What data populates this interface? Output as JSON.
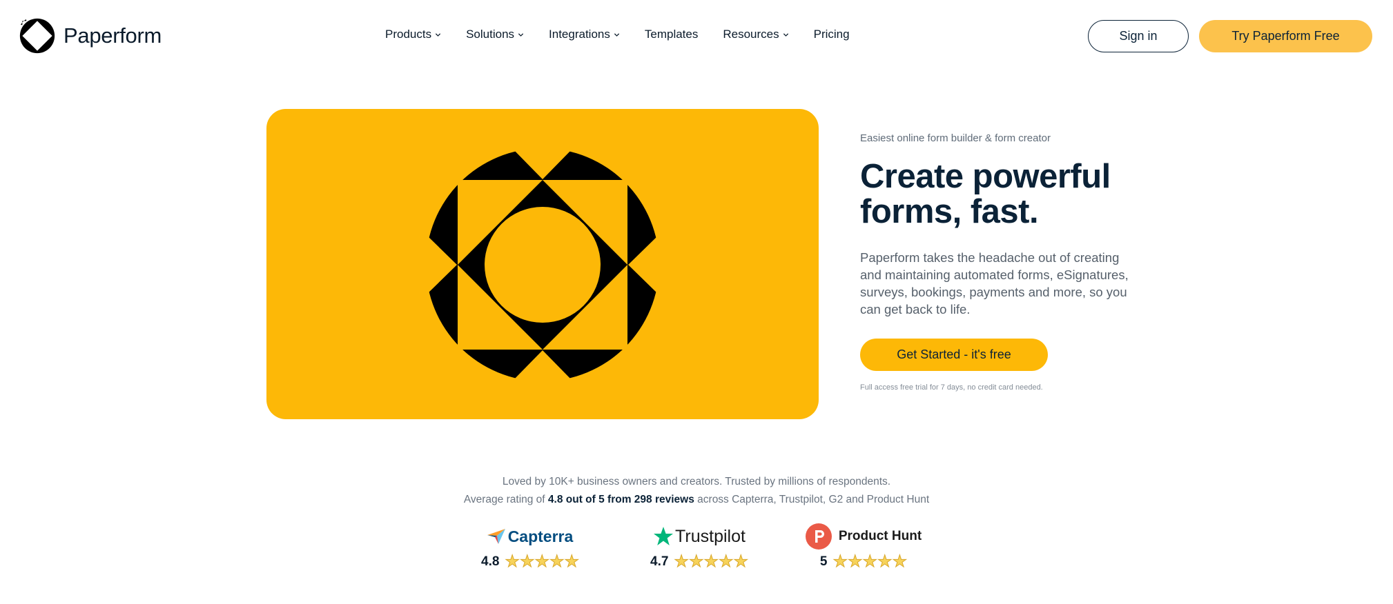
{
  "brand": {
    "name": "Paperform",
    "accent": "#fdb807",
    "accent_light": "#fcc24c",
    "ink": "#0b2237"
  },
  "nav": {
    "items": [
      {
        "label": "Products",
        "has_dropdown": true
      },
      {
        "label": "Solutions",
        "has_dropdown": true
      },
      {
        "label": "Integrations",
        "has_dropdown": true
      },
      {
        "label": "Templates",
        "has_dropdown": false
      },
      {
        "label": "Resources",
        "has_dropdown": true
      },
      {
        "label": "Pricing",
        "has_dropdown": false
      }
    ],
    "sign_in": "Sign in",
    "try_free": "Try Paperform Free"
  },
  "hero": {
    "eyebrow": "Easiest online form builder & form creator",
    "headline_line1": "Create powerful",
    "headline_line2": "forms, fast.",
    "description": "Paperform takes the headache out of creating and maintaining automated forms, eSignatures, surveys, bookings, payments and more, so you can get back to life.",
    "cta": "Get Started - it's free",
    "fineprint": "Full access free trial for 7 days, no credit card needed."
  },
  "social_proof": {
    "line1": "Loved by 10K+ business owners and creators. Trusted by millions of respondents.",
    "line2_prefix": "Average rating of",
    "line2_bold": "4.8 out of 5 from 298 reviews",
    "line2_suffix": "across Capterra, Trustpilot, G2 and Product Hunt",
    "ratings": [
      {
        "brand": "Capterra",
        "score": "4.8",
        "stars": 5,
        "icon": "capterra-arrow-icon"
      },
      {
        "brand": "Trustpilot",
        "score": "4.7",
        "stars": 5,
        "icon": "trustpilot-star-icon"
      },
      {
        "brand": "Product Hunt",
        "score": "5",
        "stars": 5,
        "icon": "product-hunt-p-icon"
      }
    ]
  }
}
